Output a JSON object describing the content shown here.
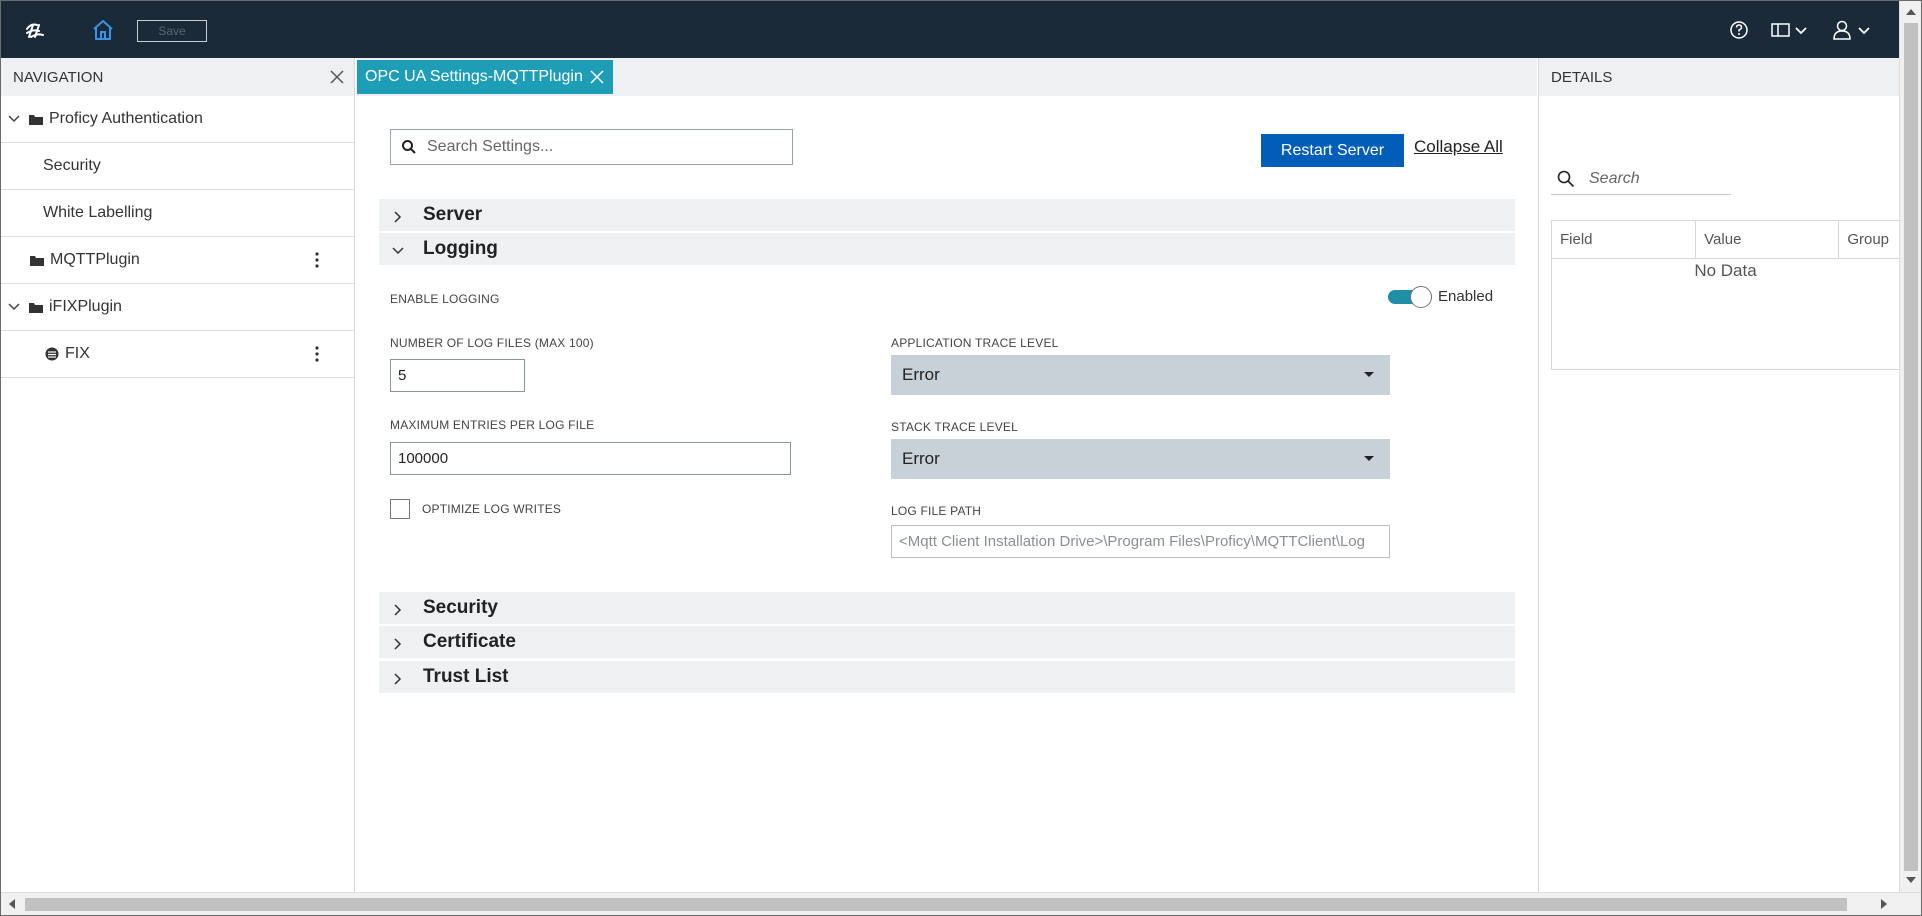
{
  "topbar": {
    "save_label": "Save"
  },
  "navigation": {
    "title": "NAVIGATION",
    "items": [
      {
        "label": "Proficy Authentication"
      },
      {
        "label": "Security"
      },
      {
        "label": "White Labelling"
      },
      {
        "label": "MQTTPlugin"
      },
      {
        "label": "iFIXPlugin"
      },
      {
        "label": "FIX"
      }
    ]
  },
  "tab": {
    "label": "OPC UA Settings-MQTTPlugin"
  },
  "main": {
    "search_placeholder": "Search Settings...",
    "restart_label": "Restart Server",
    "collapse_all_label": "Collapse All",
    "sections": {
      "server": "Server",
      "logging": "Logging",
      "security": "Security",
      "certificate": "Certificate",
      "trust_list": "Trust List"
    },
    "logging": {
      "enable_label": "ENABLE LOGGING",
      "enable_state": "Enabled",
      "num_files_label": "NUMBER OF LOG FILES (MAX 100)",
      "num_files_value": "5",
      "max_entries_label": "MAXIMUM ENTRIES PER LOG FILE",
      "max_entries_value": "100000",
      "optimize_label": "OPTIMIZE LOG WRITES",
      "app_trace_label": "APPLICATION TRACE LEVEL",
      "app_trace_value": "Error",
      "stack_trace_label": "STACK TRACE LEVEL",
      "stack_trace_value": "Error",
      "log_path_label": "LOG FILE PATH",
      "log_path_placeholder": "<Mqtt Client Installation Drive>\\Program Files\\Proficy\\MQTTClient\\Log"
    }
  },
  "details": {
    "title": "DETAILS",
    "search_placeholder": "Search",
    "columns": [
      "Field",
      "Value",
      "Group"
    ],
    "empty_text": "No Data"
  },
  "colors": {
    "topbar": "#1b2a38",
    "tab_active": "#1e9db6",
    "primary_button": "#005eb8",
    "toggle_on": "#1e8fa6"
  }
}
